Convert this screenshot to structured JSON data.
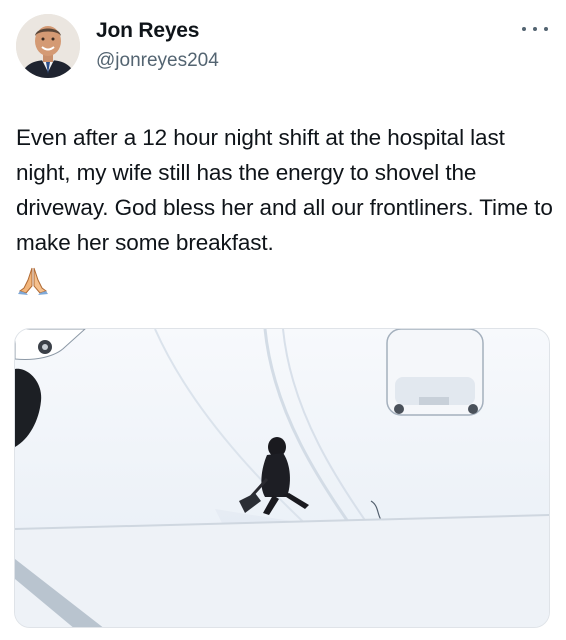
{
  "author": {
    "display_name": "Jon Reyes",
    "handle": "@jonreyes204"
  },
  "tweet": {
    "text": "Even after a 12 hour night shift at the hospital last night, my wife still has the energy to shovel the driveway. God bless her and all our frontliners. Time to make her some breakfast.",
    "emoji": "folded-hands",
    "media": "photo-person-shoveling-snow-driveway"
  },
  "icons": {
    "more": "more-horizontal-icon"
  },
  "colors": {
    "text": "#0f1419",
    "secondary_text": "#536471",
    "snow": "#f3f7fb"
  }
}
